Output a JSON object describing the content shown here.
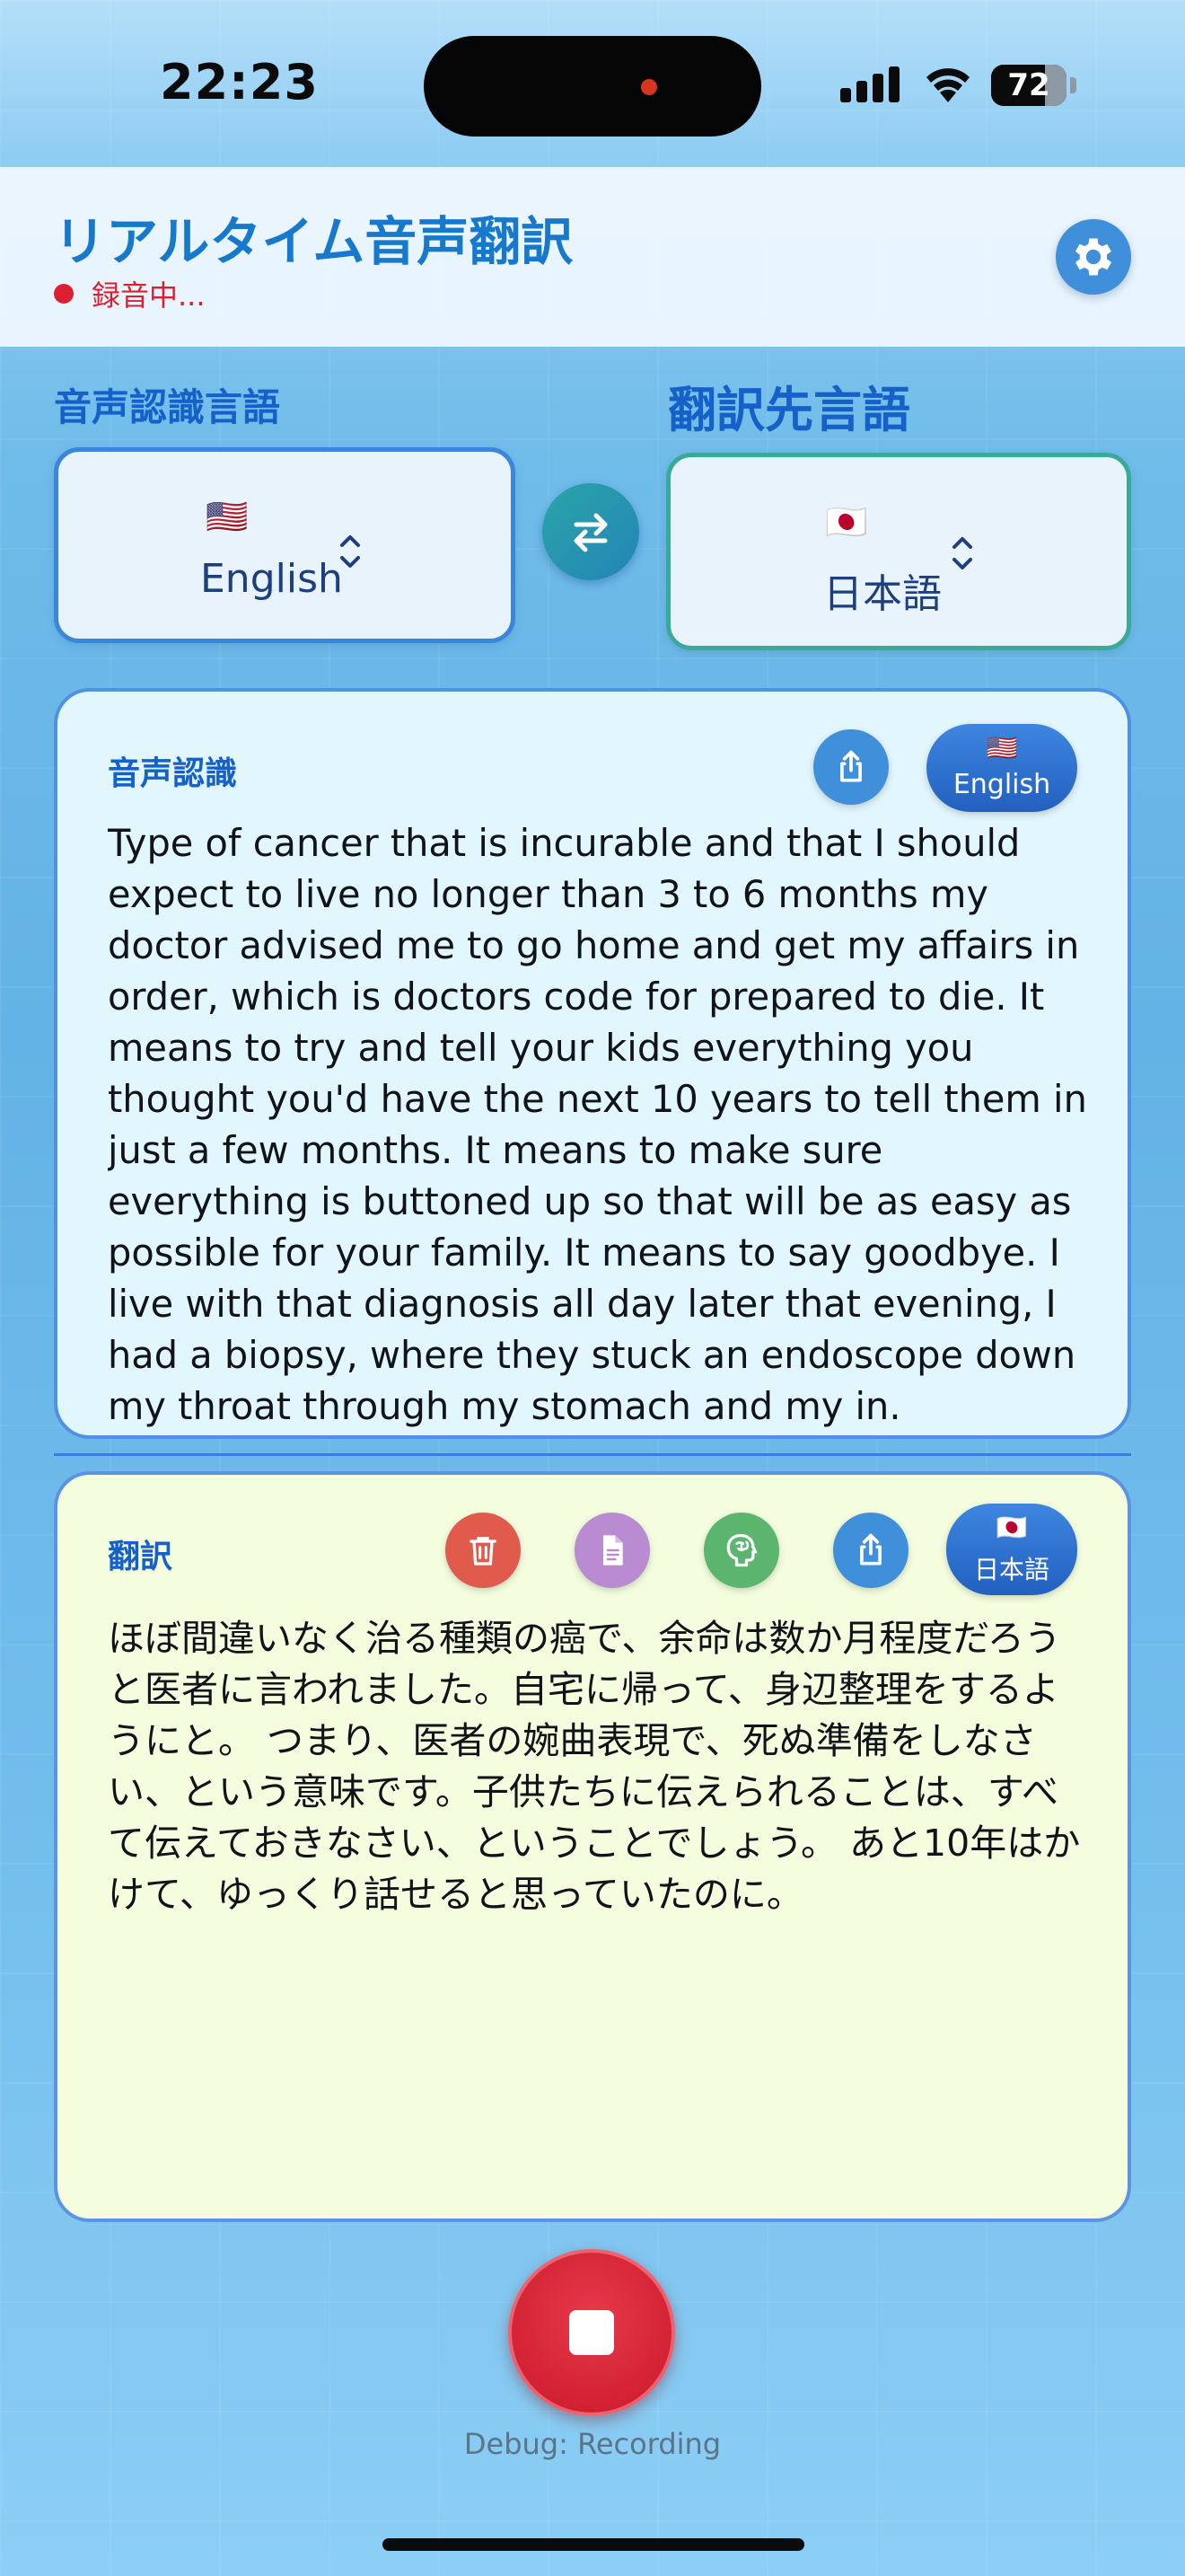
{
  "status_bar": {
    "time": "22:23",
    "battery": "72",
    "battery_level": 0.72
  },
  "header": {
    "title": "リアルタイム音声翻訳",
    "status": "録音中..."
  },
  "languages": {
    "source_label": "音声認識言語",
    "target_label": "翻訳先言語",
    "source": {
      "flag": "🇺🇸",
      "name": "English"
    },
    "target": {
      "flag": "🇯🇵",
      "name": "日本語"
    }
  },
  "recognition": {
    "title": "音声認識",
    "lang_badge": {
      "flag": "🇺🇸",
      "label": "English"
    },
    "text": "Type of cancer that is incurable and that I should expect to live no longer than 3 to 6 months my doctor advised me to go home and get my affairs in order, which is doctors code for prepared to die. It means to try and tell your kids everything you thought you'd have the next 10 years to tell them in just a few months. It means to make sure everything is buttoned up so that will be as easy as possible for your family. It means to say goodbye. I live with that diagnosis all day later that evening, I had a biopsy, where they stuck an endoscope down my throat through my stomach and my in."
  },
  "translation": {
    "title": "翻訳",
    "lang_badge": {
      "flag": "🇯🇵",
      "label": "日本語"
    },
    "text": "ほぼ間違いなく治る種類の癌で、余命は数か月程度だろうと医者に言われました。自宅に帰って、身辺整理をするようにと。 つまり、医者の婉曲表現で、死ぬ準備をしなさい、という意味です。子供たちに伝えられることは、すべて伝えておきなさい、ということでしょう。 あと10年はかけて、ゆっくり話せると思っていたのに。"
  },
  "footer": {
    "debug": "Debug: Recording"
  },
  "colors": {
    "accent": "#1779cc",
    "recording": "#dc2031",
    "delete_btn": "#e05b4c",
    "doc_btn": "#b98bd1",
    "brain_btn": "#5bb56e",
    "share_btn": "#3f8fdb"
  },
  "icons": [
    "gear-icon",
    "swap-icon",
    "chevron-updown-icon",
    "share-icon",
    "trash-icon",
    "document-icon",
    "brain-icon",
    "stop-icon"
  ]
}
